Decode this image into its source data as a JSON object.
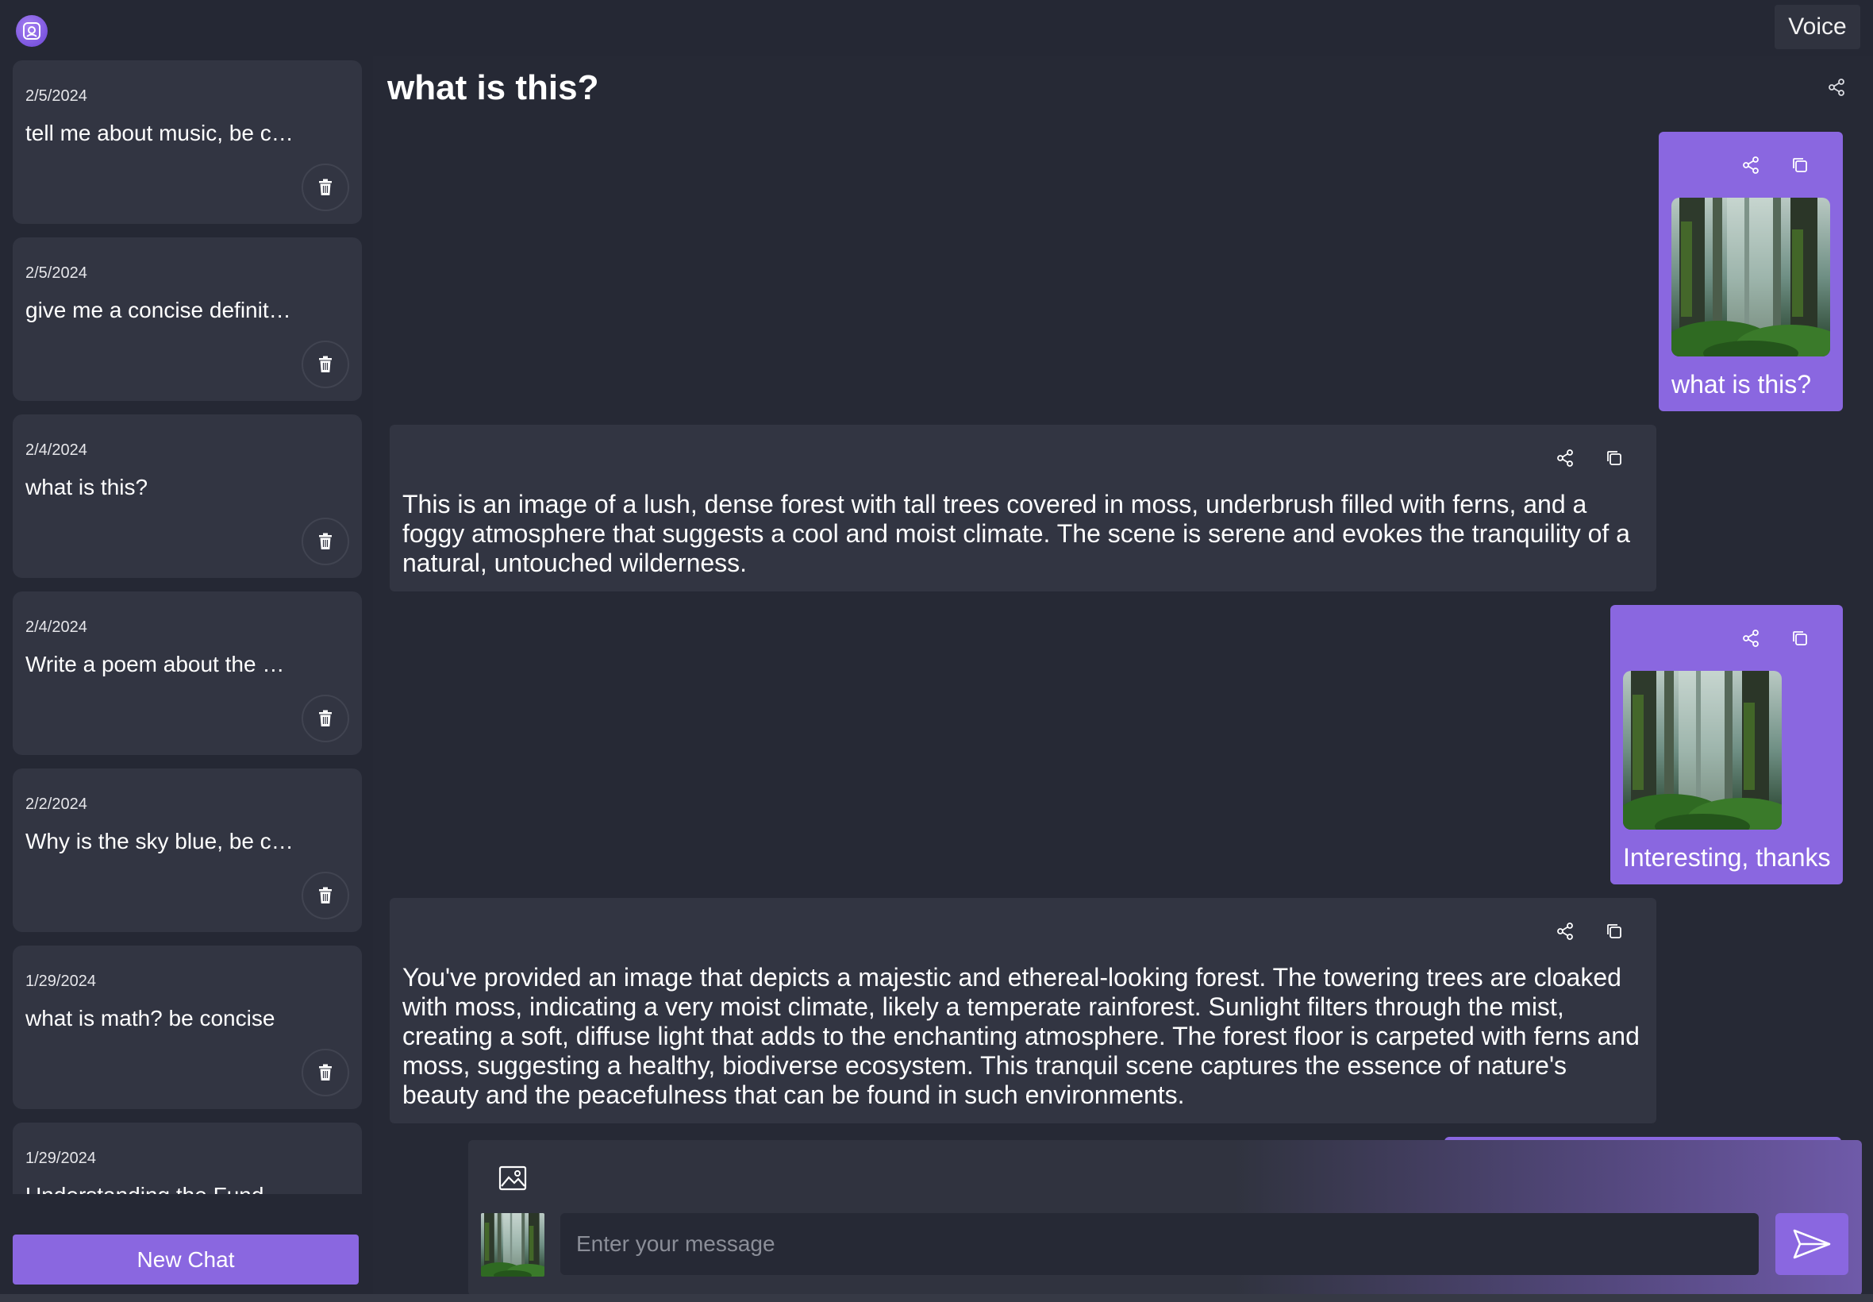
{
  "app": {
    "logo_icon": "brain-chip-icon",
    "voice_label": "Voice"
  },
  "sidebar": {
    "chats": [
      {
        "date": "2/5/2024",
        "title": "tell me about music, be concise"
      },
      {
        "date": "2/5/2024",
        "title": "give me a concise definition"
      },
      {
        "date": "2/4/2024",
        "title": "what is this?"
      },
      {
        "date": "2/4/2024",
        "title": "Write a poem about the sea"
      },
      {
        "date": "2/2/2024",
        "title": "Why is the sky blue, be concise"
      },
      {
        "date": "1/29/2024",
        "title": "what is math? be concise"
      },
      {
        "date": "1/29/2024",
        "title": "Understanding the Fund"
      }
    ],
    "new_chat_label": "New Chat"
  },
  "conversation": {
    "title": "what is this?",
    "messages": [
      {
        "role": "user",
        "text": "what is this?",
        "image": "forest-image"
      },
      {
        "role": "assistant",
        "text": "This is an image of a lush, dense forest with tall trees covered in moss, underbrush filled with ferns, and a foggy atmosphere that suggests a cool and moist climate. The scene is serene and evokes the tranquility of a natural, untouched wilderness."
      },
      {
        "role": "user",
        "text": "Interesting, thanks",
        "image": "forest-image"
      },
      {
        "role": "assistant",
        "text": "You've provided an image that depicts a majestic and ethereal-looking forest. The towering trees are cloaked with moss, indicating a very moist climate, likely a temperate rainforest. Sunlight filters through the mist, creating a soft, diffuse light that adds to the enchanting atmosphere. The forest floor is carpeted with ferns and moss, suggesting a healthy, biodiverse ecosystem. This tranquil scene captures the essence of nature's beauty and the peacefulness that can be found in such environments."
      }
    ]
  },
  "composer": {
    "placeholder": "Enter your message",
    "value": ""
  },
  "colors": {
    "accent": "#8a67e0",
    "background": "#262935",
    "card": "#323542"
  }
}
